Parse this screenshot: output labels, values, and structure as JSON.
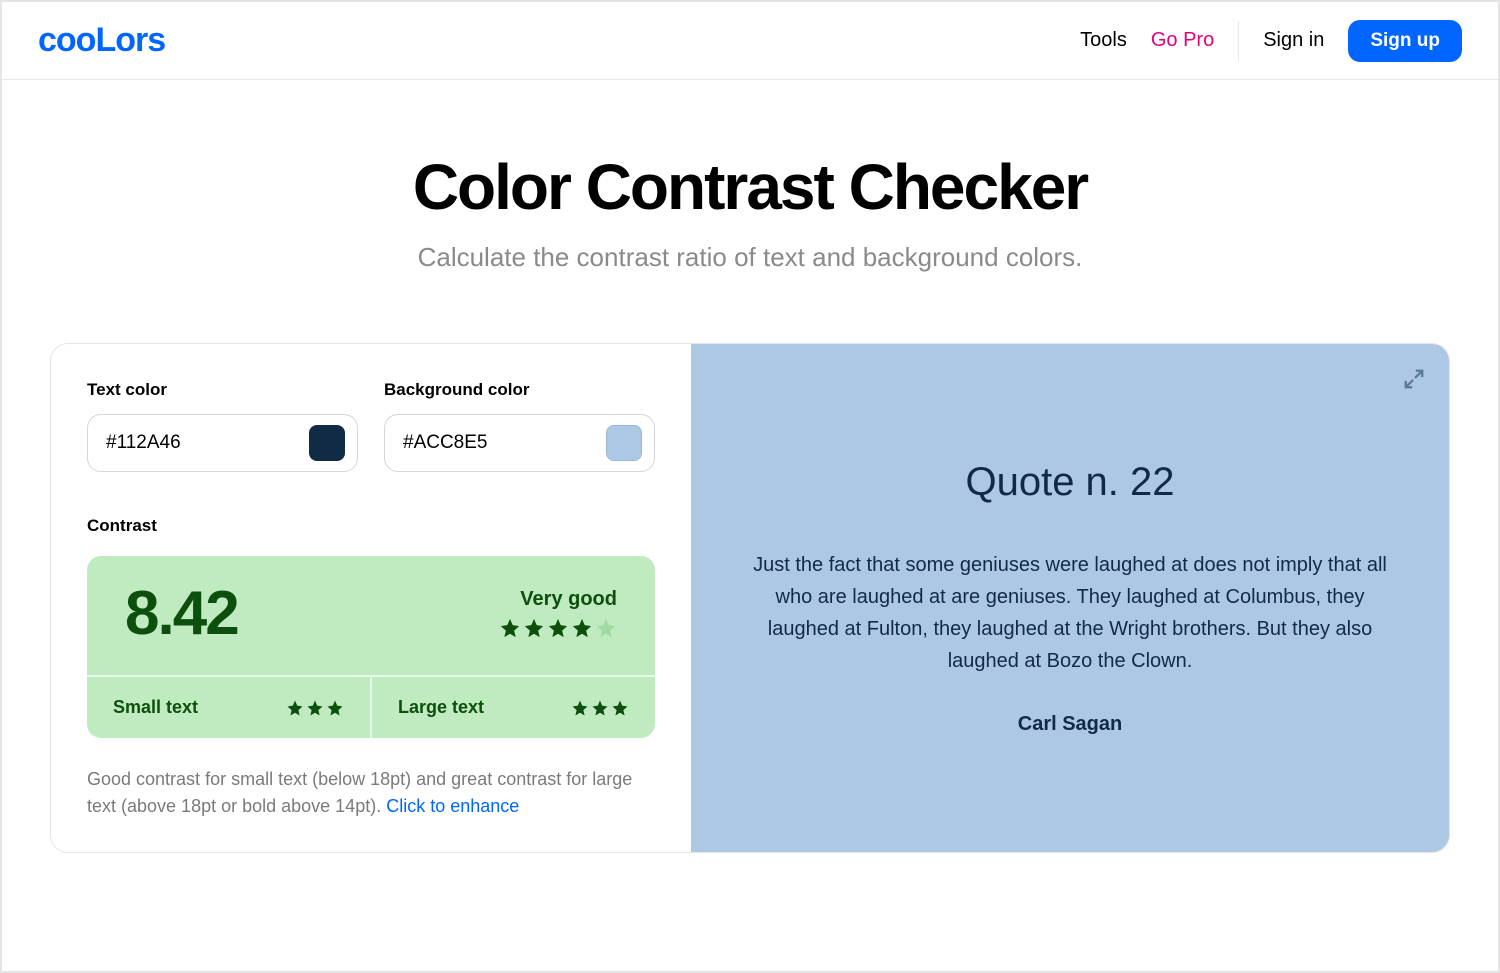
{
  "header": {
    "logo": "cooLors",
    "nav": {
      "tools": "Tools",
      "go_pro": "Go Pro",
      "sign_in": "Sign in",
      "sign_up": "Sign up"
    }
  },
  "hero": {
    "title": "Color Contrast Checker",
    "subtitle": "Calculate the contrast ratio of text and background colors."
  },
  "inputs": {
    "text_label": "Text color",
    "text_value": "#112A46",
    "bg_label": "Background color",
    "bg_value": "#ACC8E5"
  },
  "contrast": {
    "label": "Contrast",
    "ratio": "8.42",
    "rating_text": "Very good",
    "stars_filled": 4,
    "stars_total": 5,
    "small_text_label": "Small text",
    "small_text_stars": 3,
    "large_text_label": "Large text",
    "large_text_stars": 3
  },
  "description": {
    "text": "Good contrast for small text (below 18pt) and great contrast for large text (above 18pt or bold above 14pt). ",
    "link": "Click to enhance"
  },
  "preview": {
    "title": "Quote n. 22",
    "quote": "Just the fact that some geniuses were laughed at does not imply that all who are laughed at are geniuses. They laughed at Columbus, they laughed at Fulton, they laughed at the Wright brothers. But they also laughed at Bozo the Clown.",
    "author": "Carl Sagan"
  },
  "colors": {
    "text_swatch": "#112A46",
    "bg_swatch": "#ACC8E5"
  }
}
